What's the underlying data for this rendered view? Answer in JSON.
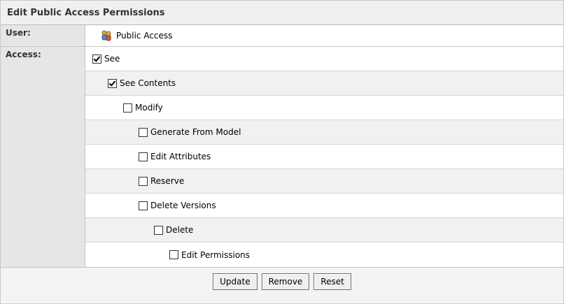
{
  "panel": {
    "title": "Edit Public Access Permissions"
  },
  "user": {
    "label": "User:",
    "value": "Public Access",
    "icon": "users-icon"
  },
  "access": {
    "label": "Access:",
    "permissions": [
      {
        "name": "See",
        "checked": true,
        "level": 0
      },
      {
        "name": "See Contents",
        "checked": true,
        "level": 1
      },
      {
        "name": "Modify",
        "checked": false,
        "level": 2
      },
      {
        "name": "Generate From Model",
        "checked": false,
        "level": 3
      },
      {
        "name": "Edit Attributes",
        "checked": false,
        "level": 3
      },
      {
        "name": "Reserve",
        "checked": false,
        "level": 3
      },
      {
        "name": "Delete Versions",
        "checked": false,
        "level": 3
      },
      {
        "name": "Delete",
        "checked": false,
        "level": 4
      },
      {
        "name": "Edit Permissions",
        "checked": false,
        "level": 5
      }
    ]
  },
  "buttons": {
    "update": "Update",
    "remove": "Remove",
    "reset": "Reset"
  }
}
